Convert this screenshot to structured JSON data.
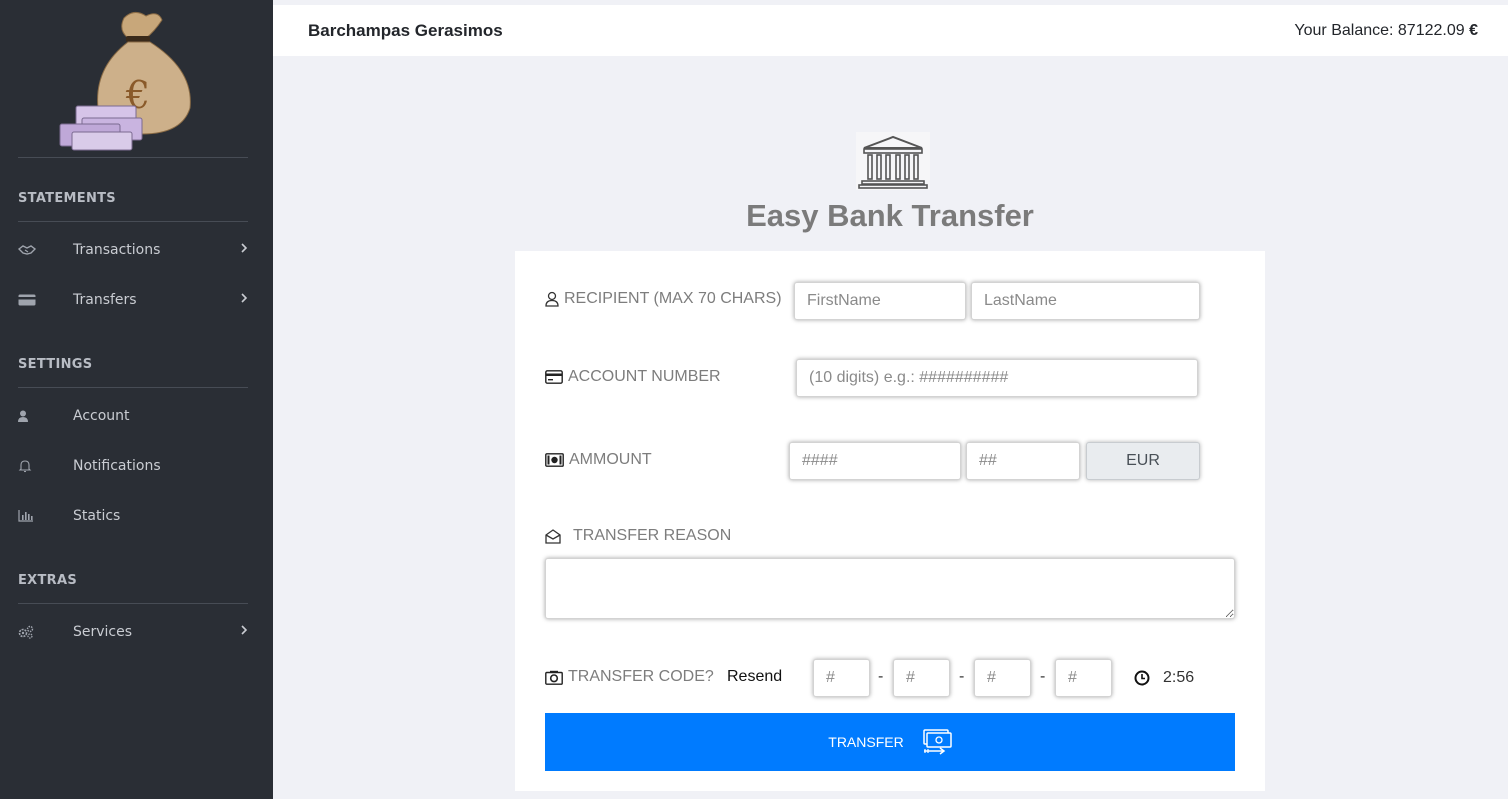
{
  "header": {
    "user_name": "Barchampas Gerasimos",
    "balance_label": "Your Balance: 87122.09",
    "balance_currency": "€"
  },
  "sidebar": {
    "logo_icon": "money-bag-euro-icon",
    "sections": {
      "statements": "STATEMENTS",
      "settings": "SETTINGS",
      "extras": "EXTRAS"
    },
    "items": {
      "transactions": "Transactions",
      "transfers": "Transfers",
      "account": "Account",
      "notifications": "Notifications",
      "statics": "Statics",
      "services": "Services"
    }
  },
  "main": {
    "title": "Easy Bank Transfer",
    "recipient_label": "RECIPIENT (MAX 70 CHARS)",
    "first_name_placeholder": "FirstName",
    "last_name_placeholder": "LastName",
    "account_label": "ACCOUNT NUMBER",
    "account_placeholder": "(10 digits) e.g.: ##########",
    "amount_label": "AMMOUNT",
    "amount_int_placeholder": "####",
    "amount_dec_placeholder": "##",
    "currency": "EUR",
    "reason_label": "TRANSFER REASON",
    "code_label": "TRANSFER CODE?",
    "resend_label": "Resend",
    "code_placeholder": "#",
    "code_separator": "-",
    "timer": "2:56",
    "submit_label": "TRANSFER"
  },
  "colors": {
    "sidebar_bg": "#2a2e35",
    "page_bg": "#f0f1f6",
    "accent": "#007bff"
  }
}
